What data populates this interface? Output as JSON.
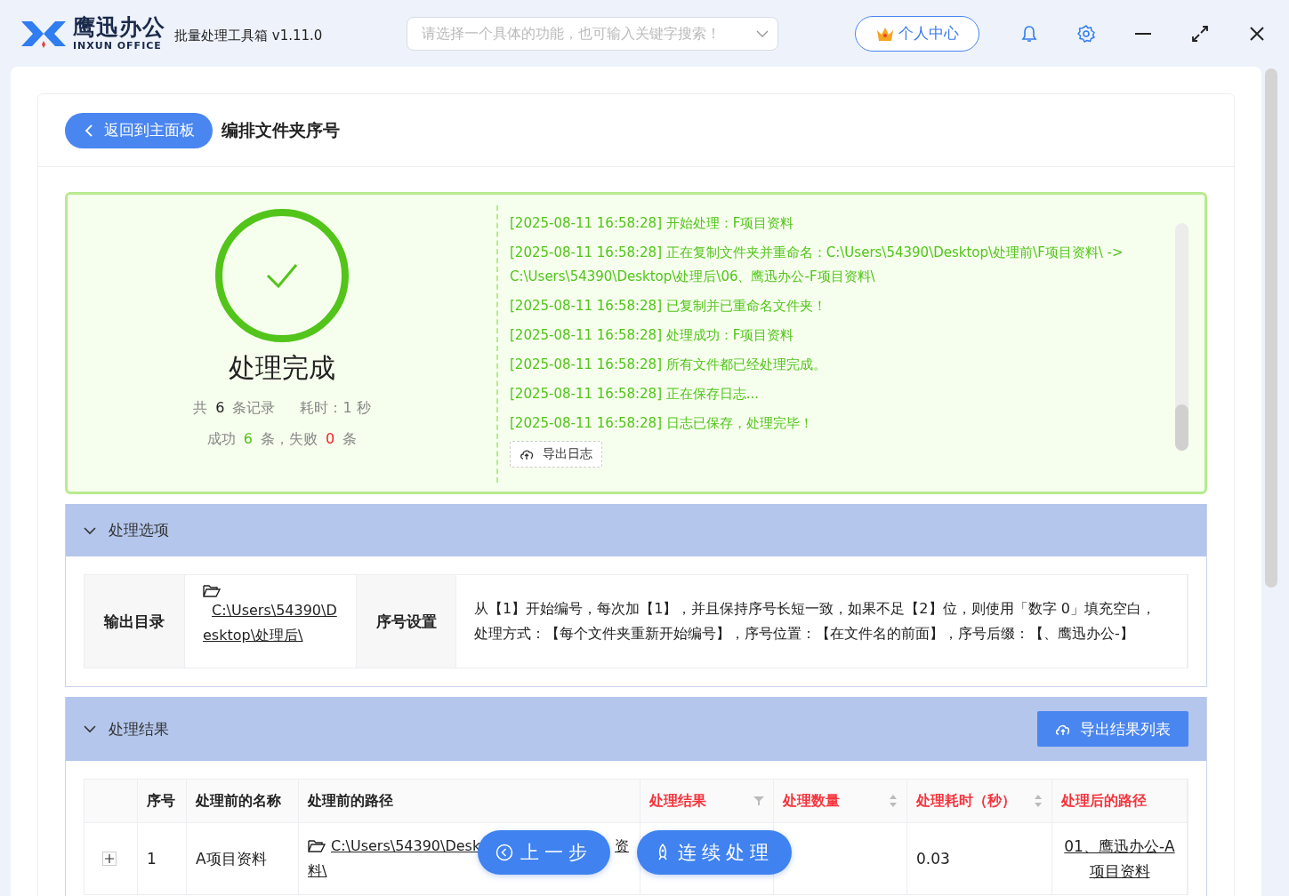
{
  "app": {
    "logo_cn": "鹰迅办公",
    "logo_en": "INXUN OFFICE",
    "title": "批量处理工具箱 v1.11.0"
  },
  "search": {
    "placeholder": "请选择一个具体的功能，也可输入关键字搜索！"
  },
  "user_button": "个人中心",
  "page": {
    "back_button": "返回到主面板",
    "title": "编排文件夹序号"
  },
  "result": {
    "status": "处理完成",
    "summary": [
      [
        {
          "kind": "text",
          "text": "共"
        },
        {
          "kind": "neutral",
          "text": "6"
        },
        {
          "kind": "text",
          "text": "条记录"
        },
        {
          "kind": "gap"
        },
        {
          "kind": "text",
          "text": "耗时：1 秒"
        }
      ],
      [
        {
          "kind": "text",
          "text": "成功"
        },
        {
          "kind": "success",
          "text": "6"
        },
        {
          "kind": "text",
          "text": "条，失败"
        },
        {
          "kind": "fail",
          "text": "0"
        },
        {
          "kind": "text",
          "text": "条"
        }
      ]
    ]
  },
  "log": {
    "lines": [
      "[2025-08-11 16:58:28] 开始处理：F项目资料",
      "[2025-08-11 16:58:28] 正在复制文件夹并重命名：C:\\Users\\54390\\Desktop\\处理前\\F项目资料\\ -> C:\\Users\\54390\\Desktop\\处理后\\06、鹰迅办公-F项目资料\\",
      "[2025-08-11 16:58:28] 已复制并已重命名文件夹！",
      "[2025-08-11 16:58:28] 处理成功：F项目资料",
      "[2025-08-11 16:58:28] 所有文件都已经处理完成。",
      "[2025-08-11 16:58:28] 正在保存日志...",
      "[2025-08-11 16:58:28] 日志已保存，处理完毕！"
    ],
    "export_button": "导出日志"
  },
  "options_section": {
    "title": "处理选项",
    "expanded": true,
    "fields": [
      {
        "label": "输出目录",
        "kind": "path",
        "value": "C:\\Users\\54390\\Desktop\\处理后\\"
      },
      {
        "label": "序号设置",
        "kind": "text",
        "value": "从【1】开始编号，每次加【1】，并且保持序号长短一致，如果不足【2】位，则使用「数字 0」填充空白，处理方式：【每个文件夹重新开始编号】，序号位置：【在文件名的前面】，序号后缀：【、鹰迅办公-】"
      }
    ]
  },
  "results_section": {
    "title": "处理结果",
    "expanded": true,
    "export_button": "导出结果列表",
    "columns": [
      {
        "label": "序号",
        "highlight": false,
        "kind": "plain"
      },
      {
        "label": "处理前的名称",
        "highlight": false,
        "kind": "plain"
      },
      {
        "label": "处理前的路径",
        "highlight": false,
        "kind": "plain"
      },
      {
        "label": "处理结果",
        "highlight": true,
        "kind": "filter"
      },
      {
        "label": "处理数量",
        "highlight": true,
        "kind": "sort"
      },
      {
        "label": "处理耗时（秒）",
        "highlight": true,
        "kind": "sort"
      },
      {
        "label": "处理后的路径",
        "highlight": true,
        "kind": "plain"
      }
    ],
    "rows": [
      {
        "expanded": false,
        "cells": [
          {
            "kind": "text",
            "text": "1"
          },
          {
            "kind": "text",
            "text": "A项目资料"
          },
          {
            "kind": "path",
            "parts": [
              "C:\\Users\\54390\\Desk",
              "资",
              "料\\"
            ]
          },
          {
            "kind": "empty"
          },
          {
            "kind": "empty"
          },
          {
            "kind": "text",
            "text": "0.03"
          },
          {
            "kind": "link",
            "text": "01、鹰迅办公-A项目资料"
          }
        ]
      }
    ]
  },
  "floating_buttons": [
    {
      "kind": "back",
      "label": "上一步"
    },
    {
      "kind": "continue",
      "label": "连续处理"
    }
  ]
}
